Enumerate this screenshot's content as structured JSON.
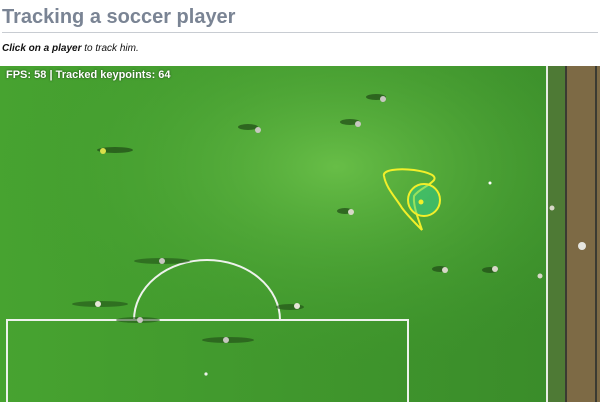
{
  "page": {
    "title": "Tracking a soccer player",
    "instructions_strong": "Click on a player",
    "instructions_rest": " to track him."
  },
  "hud": {
    "fps_label": "FPS:",
    "fps": "58",
    "separator": "|",
    "keypoints_label": "Tracked keypoints:",
    "keypoints": "64"
  },
  "colors": {
    "title": "#7a8494",
    "pitch": "#3f9a2c",
    "pitch_light": "#56b43a",
    "track_overlay": "#f2ef2a",
    "track_fill": "#2fd39a"
  },
  "icons": {
    "player_marker": "player-icon",
    "track_circle": "tracking-circle-icon"
  }
}
